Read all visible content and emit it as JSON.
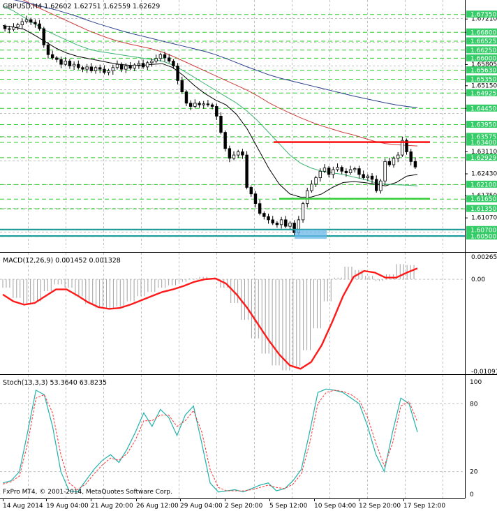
{
  "window": {
    "symbol_header": "GBPUSD,H4  1.62602 1.62751 1.62559 1.62629",
    "copyright": "FxPro MT4, © 2001-2014, MetaQuotes Software Corp."
  },
  "colors": {
    "background": "#ffffff",
    "grid": "#c0c0c0",
    "price_line": "#000000",
    "ma_fast": "#000000",
    "ma_mid": "#3cb371",
    "ma_slow": "#cd3c3c",
    "ma_longest": "#2a3e8c",
    "resistance": "#ff0000",
    "support": "#2ecc2e",
    "support_zone": "#1a9a9a",
    "macd_signal": "#ff1a1a",
    "macd_hist": "#a0a0a0",
    "stoch_main": "#20b2aa",
    "stoch_signal": "#ff3030",
    "level_label_bg": "#33cc66",
    "current_label_bg": "#000000"
  },
  "chart_data": [
    {
      "type": "candlestick",
      "title": "GBPUSD,H4",
      "header_values": {
        "open": 1.62602,
        "high": 1.62751,
        "low": 1.62559,
        "close": 1.62629
      },
      "x_tick_labels": [
        "14 Aug 2014",
        "19 Aug 04:00",
        "21 Aug 20:00",
        "26 Aug 12:00",
        "29 Aug 04:00",
        "2 Sep 20:00",
        "5 Sep 12:00",
        "10 Sep 04:00",
        "12 Sep 20:00",
        "17 Sep 12:00"
      ],
      "ylim": [
        1.602,
        1.677
      ],
      "y_tick_labels": [
        "1.67210",
        "1.66800",
        "1.65805",
        "1.65150",
        "1.64920",
        "1.64450",
        "1.63110",
        "1.62430",
        "1.61750",
        "1.61070"
      ],
      "price_levels": [
        "1.67350",
        "1.66800",
        "1.66525",
        "1.66250",
        "1.66000",
        "1.65630",
        "1.65350",
        "1.64925",
        "1.64450",
        "1.63950",
        "1.63575",
        "1.63400",
        "1.62929",
        "1.62100",
        "1.61650",
        "1.61350",
        "1.60700",
        "1.60500"
      ],
      "current_price": "1.62629",
      "resistance_level": 1.634,
      "support_level": 1.6165,
      "support_zone_levels": [
        1.607,
        1.605
      ],
      "close_series": [
        1.669,
        1.6688,
        1.6695,
        1.6702,
        1.6712,
        1.6718,
        1.671,
        1.6705,
        1.669,
        1.664,
        1.661,
        1.66,
        1.6595,
        1.658,
        1.659,
        1.6575,
        1.658,
        1.657,
        1.6565,
        1.6572,
        1.656,
        1.657,
        1.6565,
        1.6555,
        1.656,
        1.657,
        1.658,
        1.6565,
        1.6575,
        1.6568,
        1.6578,
        1.6583,
        1.6572,
        1.6585,
        1.659,
        1.6598,
        1.661,
        1.66,
        1.659,
        1.6575,
        1.653,
        1.6495,
        1.646,
        1.645,
        1.646,
        1.6455,
        1.6458,
        1.6455,
        1.645,
        1.642,
        1.637,
        1.632,
        1.629,
        1.63,
        1.631,
        1.63,
        1.62,
        1.618,
        1.615,
        1.612,
        1.611,
        1.61,
        1.609,
        1.6085,
        1.61,
        1.608,
        1.609,
        1.606,
        1.61,
        1.615,
        1.619,
        1.621,
        1.623,
        1.625,
        1.626,
        1.624,
        1.6255,
        1.6262,
        1.625,
        1.6245,
        1.6255,
        1.6258,
        1.624,
        1.623,
        1.6235,
        1.6225,
        1.619,
        1.622,
        1.628,
        1.627,
        1.629,
        1.63,
        1.6345,
        1.631,
        1.628,
        1.6263
      ],
      "moving_averages": [
        {
          "role": "fast",
          "values": [
            1.67,
            1.6695,
            1.6688,
            1.667,
            1.665,
            1.663,
            1.6615,
            1.6605,
            1.6598,
            1.6592,
            1.6585,
            1.658,
            1.6577,
            1.6576,
            1.658,
            1.6582,
            1.657,
            1.6545,
            1.6515,
            1.649,
            1.647,
            1.6455,
            1.6425,
            1.638,
            1.632,
            1.626,
            1.621,
            1.618,
            1.617,
            1.617,
            1.618,
            1.62,
            1.6215,
            1.6218,
            1.6215,
            1.621,
            1.6205,
            1.6215,
            1.6235,
            1.624
          ]
        },
        {
          "role": "mid",
          "values": [
            1.676,
            1.6745,
            1.6725,
            1.6705,
            1.6685,
            1.667,
            1.6655,
            1.664,
            1.6628,
            1.662,
            1.6615,
            1.661,
            1.6605,
            1.66,
            1.6595,
            1.659,
            1.6578,
            1.656,
            1.654,
            1.652,
            1.65,
            1.648,
            1.646,
            1.6435,
            1.6405,
            1.637,
            1.6335,
            1.63,
            1.6275,
            1.626,
            1.625,
            1.6245,
            1.624,
            1.6232,
            1.6225,
            1.6215,
            1.621,
            1.6208,
            1.6207,
            1.6205
          ]
        },
        {
          "role": "slow",
          "values": [
            1.68,
            1.679,
            1.6778,
            1.676,
            1.6745,
            1.673,
            1.6715,
            1.67,
            1.6685,
            1.6672,
            1.666,
            1.665,
            1.6642,
            1.6635,
            1.6628,
            1.6618,
            1.6605,
            1.659,
            1.6575,
            1.656,
            1.6545,
            1.653,
            1.6515,
            1.65,
            1.6482,
            1.6462,
            1.6445,
            1.643,
            1.6415,
            1.6402,
            1.639,
            1.638,
            1.637,
            1.6362,
            1.6352,
            1.6342,
            1.6335,
            1.6332,
            1.633,
            1.6328
          ]
        },
        {
          "role": "longest",
          "values": [
            1.679,
            1.678,
            1.6772,
            1.6765,
            1.6756,
            1.6748,
            1.6738,
            1.6728,
            1.6716,
            1.6705,
            1.6695,
            1.6685,
            1.6676,
            1.6668,
            1.666,
            1.6652,
            1.6644,
            1.6636,
            1.6628,
            1.662,
            1.661,
            1.6598,
            1.6585,
            1.6572,
            1.656,
            1.6548,
            1.6538,
            1.653,
            1.6522,
            1.6514,
            1.6506,
            1.6498,
            1.649,
            1.6482,
            1.6475,
            1.6468,
            1.6461,
            1.6455,
            1.645,
            1.6446
          ]
        }
      ]
    },
    {
      "type": "bar",
      "title": "MACD(12,26,9) 0.001452 0.001328",
      "ylim": [
        -0.01091,
        0.002659
      ],
      "y_tick_labels": [
        "0.002659",
        "0.00",
        "-0.010914"
      ],
      "signal": [
        -0.0018,
        -0.0026,
        -0.003,
        -0.0028,
        -0.002,
        -0.0012,
        -0.0012,
        -0.0019,
        -0.0027,
        -0.0033,
        -0.0035,
        -0.0034,
        -0.003,
        -0.0025,
        -0.002,
        -0.0015,
        -0.0012,
        -0.0008,
        -0.0003,
        0.0,
        0.0001,
        -0.0005,
        -0.0018,
        -0.0034,
        -0.0053,
        -0.0072,
        -0.0089,
        -0.0102,
        -0.0106,
        -0.0098,
        -0.0078,
        -0.005,
        -0.002,
        0.0003,
        0.001,
        0.0008,
        0.0002,
        0.0002,
        0.0008,
        0.0013
      ],
      "histogram": [
        -0.001,
        -0.0022,
        -0.003,
        -0.0026,
        -0.0014,
        -0.0006,
        -0.001,
        -0.002,
        -0.0029,
        -0.0034,
        -0.0035,
        -0.0032,
        -0.0026,
        -0.002,
        -0.0015,
        -0.001,
        -0.0007,
        -0.0003,
        0.0001,
        0.0003,
        0.0001,
        -0.001,
        -0.0028,
        -0.0048,
        -0.007,
        -0.0088,
        -0.0102,
        -0.0108,
        -0.0103,
        -0.0084,
        -0.0058,
        -0.0026,
        0.0002,
        0.0015,
        0.0011,
        0.0004,
        -0.0002,
        0.0006,
        0.0018,
        0.0017
      ]
    },
    {
      "type": "line",
      "title": "Stoch(13,3,3) 53.3640 63.8235",
      "ylim": [
        0,
        100
      ],
      "y_tick_labels": [
        "100",
        "80",
        "20",
        "0"
      ],
      "series": [
        {
          "role": "main",
          "values": [
            10,
            12,
            20,
            55,
            92,
            88,
            60,
            20,
            3,
            2,
            12,
            22,
            30,
            35,
            28,
            40,
            55,
            72,
            60,
            75,
            68,
            52,
            70,
            78,
            45,
            10,
            2,
            3,
            4,
            2,
            5,
            8,
            10,
            3,
            5,
            12,
            22,
            55,
            90,
            93,
            92,
            90,
            85,
            80,
            60,
            35,
            20,
            55,
            85,
            80,
            55
          ]
        },
        {
          "role": "signal",
          "values": [
            9,
            11,
            16,
            45,
            85,
            88,
            72,
            35,
            10,
            4,
            9,
            18,
            26,
            32,
            30,
            36,
            48,
            65,
            65,
            70,
            70,
            60,
            65,
            74,
            55,
            22,
            6,
            3,
            3,
            3,
            4,
            6,
            8,
            6,
            5,
            9,
            18,
            45,
            80,
            90,
            92,
            91,
            88,
            83,
            68,
            45,
            25,
            45,
            78,
            82,
            64
          ]
        }
      ]
    }
  ]
}
